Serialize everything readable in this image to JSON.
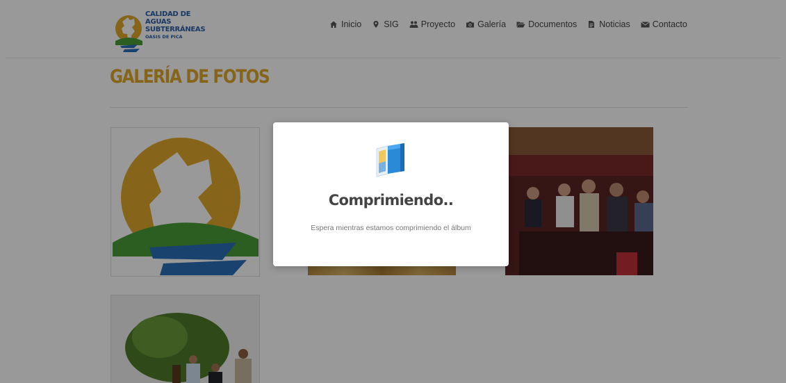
{
  "site": {
    "logo": {
      "line1": "CALIDAD DE AGUAS",
      "line2": "SUBTERRÁNEAS",
      "line3": "OASIS DE PICA"
    },
    "nav": [
      {
        "label": "Inicio",
        "icon": "home-icon"
      },
      {
        "label": "SIG",
        "icon": "map-marker-icon"
      },
      {
        "label": "Proyecto",
        "icon": "users-icon"
      },
      {
        "label": "Galería",
        "icon": "camera-icon"
      },
      {
        "label": "Documentos",
        "icon": "folder-open-icon"
      },
      {
        "label": "Noticias",
        "icon": "file-text-icon"
      },
      {
        "label": "Contacto",
        "icon": "envelope-icon"
      }
    ]
  },
  "page": {
    "title": "GALERÍA DE FOTOS"
  },
  "gallery": [
    {
      "name": "logo-photo",
      "alt": ""
    },
    {
      "name": "wood-photo",
      "alt": ""
    },
    {
      "name": "auditorium-photo",
      "alt": ""
    },
    {
      "name": "field-photo",
      "alt": ""
    }
  ],
  "modal": {
    "title": "Comprimiendo..",
    "message": "Espera mientras estamos comprimiendo el álbum",
    "icon": "album-icon"
  },
  "colors": {
    "accent": "#e0a92c",
    "brand_blue": "#2a5fa8",
    "overlay": "rgba(0,0,0,0.4)"
  }
}
